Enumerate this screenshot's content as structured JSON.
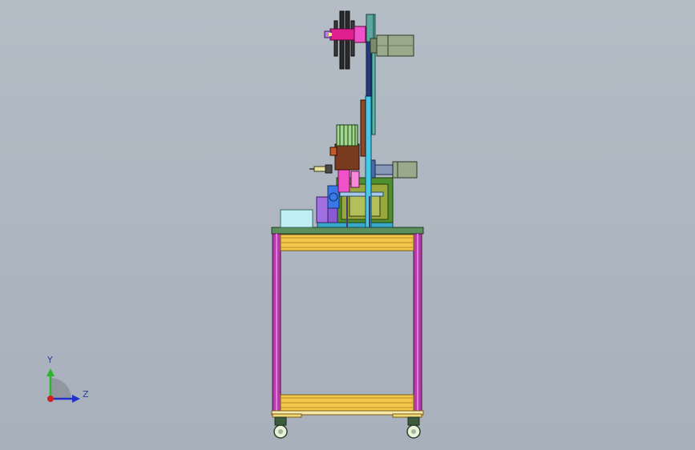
{
  "triad": {
    "y_label": "Y",
    "z_label": "Z",
    "colors": {
      "y_axis": "#2bb52b",
      "z_axis": "#2233cc",
      "origin": "#d21e1e"
    }
  },
  "colors": {
    "frame_post": "#b63aa8",
    "frame_inner": "#e07ae0",
    "crossbar": "#f2c84b",
    "crossbar_edge": "#b78a2a",
    "table_top": "#5b8f5b",
    "base_plate": "#38a8c8",
    "cyan_column": "#46c8e8",
    "navy_column": "#233a7a",
    "brown_column": "#8b4a2a",
    "motor": "#9aa88c",
    "magenta": "#e0208e",
    "green_block": "#4f8f2f",
    "olive_block": "#98a83a",
    "light_cyan_box": "#bfeff2",
    "wheel": "#e8f3d8"
  }
}
